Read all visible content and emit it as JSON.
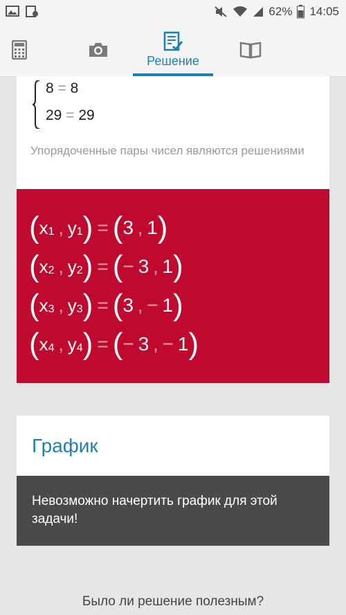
{
  "status": {
    "battery": "62%",
    "time": "14:05"
  },
  "tabs": [
    {
      "name": "calculator",
      "label": ""
    },
    {
      "name": "camera",
      "label": ""
    },
    {
      "name": "solution",
      "label": "Решение"
    },
    {
      "name": "book",
      "label": ""
    }
  ],
  "system": {
    "eq1_left": "8",
    "eq1_op": "=",
    "eq1_right": "8",
    "eq2_left": "29",
    "eq2_op": "=",
    "eq2_right": "29"
  },
  "note": "Упорядоченные пары чисел являются решениями",
  "solutions": [
    {
      "i": "1",
      "x": "3",
      "y": "1",
      "x_minus": false,
      "y_minus": false
    },
    {
      "i": "2",
      "x": "3",
      "y": "1",
      "x_minus": true,
      "y_minus": false
    },
    {
      "i": "3",
      "x": "3",
      "y": "1",
      "x_minus": false,
      "y_minus": true
    },
    {
      "i": "4",
      "x": "3",
      "y": "1",
      "x_minus": true,
      "y_minus": true
    }
  ],
  "answer_labels": {
    "x": "x",
    "y": "y",
    "comma": ",",
    "equals": "=",
    "open": "(",
    "close": ")",
    "minus": "−"
  },
  "graph": {
    "title": "График",
    "message": "Невозможно начертить график для этой задачи!"
  },
  "feedback": "Было ли решение полезным?",
  "colors": {
    "accent": "#1c7fb8",
    "answer_bg": "#c0092f",
    "message_bg": "#4a4a4a"
  }
}
